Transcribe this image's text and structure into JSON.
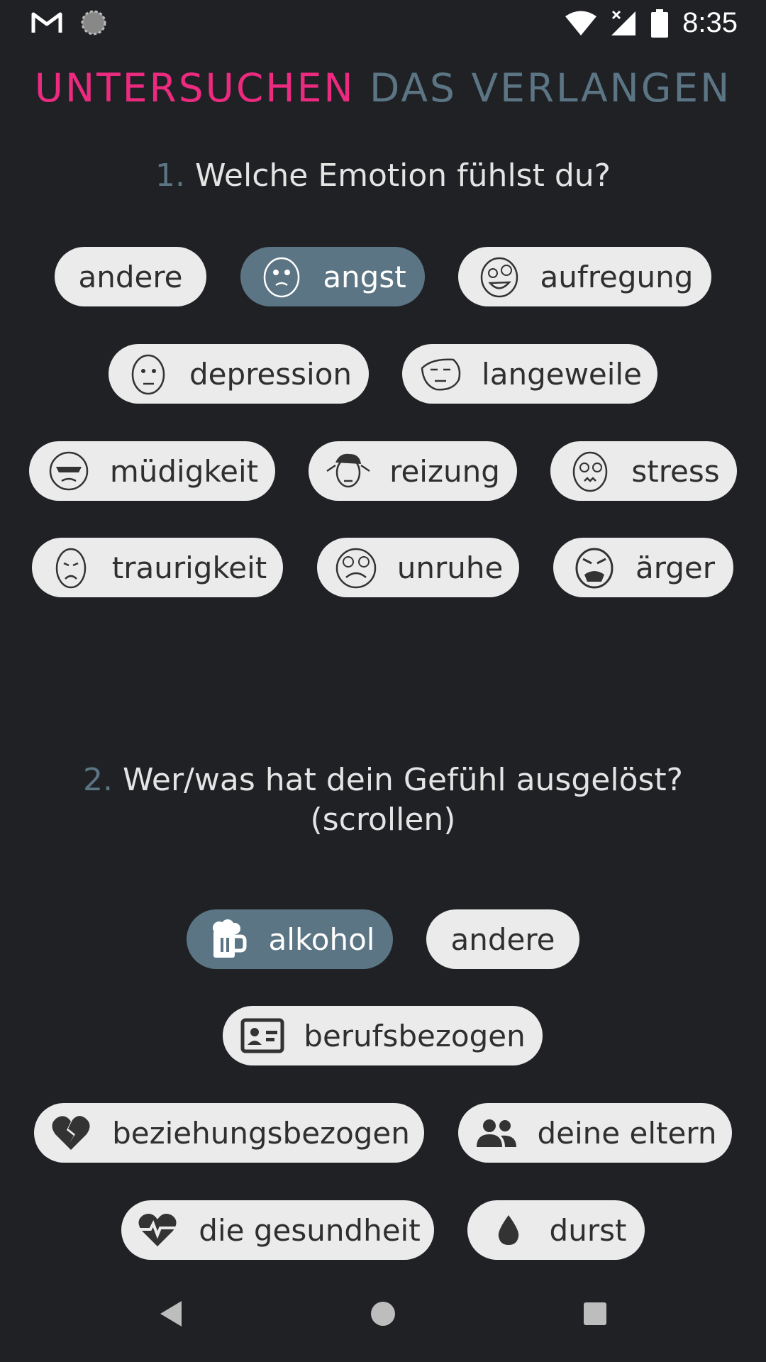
{
  "status_bar": {
    "time": "8:35",
    "icons": [
      "gmail-icon",
      "sync-icon",
      "wifi-icon",
      "signal-icon",
      "battery-icon"
    ]
  },
  "header": {
    "title_part1": "UNTERSUCHEN",
    "title_part2": "DAS VERLANGEN",
    "accent_color": "#ec2a80",
    "secondary_color": "#5b7585"
  },
  "section1": {
    "number": "1.",
    "question": "Welche Emotion fühlst du?",
    "options": [
      {
        "label": "andere",
        "selected": false,
        "icon": ""
      },
      {
        "label": "angst",
        "selected": true,
        "icon": "fear-face-icon"
      },
      {
        "label": "aufregung",
        "selected": false,
        "icon": "excited-face-icon"
      },
      {
        "label": "depression",
        "selected": false,
        "icon": "depressed-face-icon"
      },
      {
        "label": "langeweile",
        "selected": false,
        "icon": "bored-face-icon"
      },
      {
        "label": "müdigkeit",
        "selected": false,
        "icon": "tired-face-icon"
      },
      {
        "label": "reizung",
        "selected": false,
        "icon": "irritated-face-icon"
      },
      {
        "label": "stress",
        "selected": false,
        "icon": "stressed-face-icon"
      },
      {
        "label": "traurigkeit",
        "selected": false,
        "icon": "sad-face-icon"
      },
      {
        "label": "unruhe",
        "selected": false,
        "icon": "restless-face-icon"
      },
      {
        "label": "ärger",
        "selected": false,
        "icon": "angry-face-icon"
      }
    ]
  },
  "section2": {
    "number": "2.",
    "question": "Wer/was hat dein Gefühl ausgelöst?",
    "question_line2": "(scrollen)",
    "options": [
      {
        "label": "alkohol",
        "selected": true,
        "icon": "beer-mug-icon"
      },
      {
        "label": "andere",
        "selected": false,
        "icon": ""
      },
      {
        "label": "berufsbezogen",
        "selected": false,
        "icon": "id-card-icon"
      },
      {
        "label": "beziehungsbezogen",
        "selected": false,
        "icon": "broken-heart-icon"
      },
      {
        "label": "deine eltern",
        "selected": false,
        "icon": "people-icon"
      },
      {
        "label": "die gesundheit",
        "selected": false,
        "icon": "heartbeat-icon"
      },
      {
        "label": "durst",
        "selected": false,
        "icon": "water-drop-icon"
      }
    ]
  },
  "navigation": {
    "buttons": [
      "back-icon",
      "home-icon",
      "recents-icon"
    ]
  }
}
